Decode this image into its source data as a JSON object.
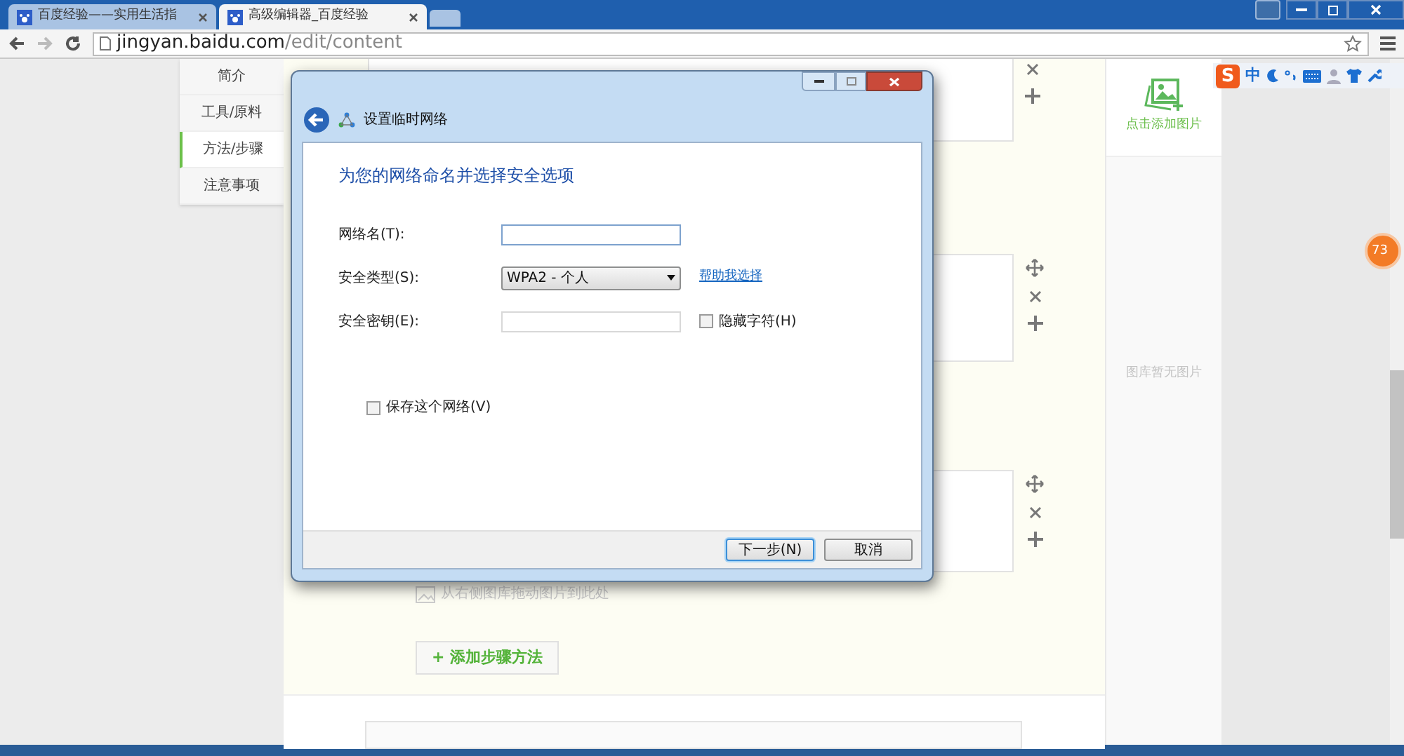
{
  "browser": {
    "tabs": [
      {
        "title": "百度经验——实用生活指",
        "selected": false
      },
      {
        "title": "高级编辑器_百度经验",
        "selected": true
      }
    ],
    "url_host": "jingyan.baidu.com",
    "url_path": "/edit/content"
  },
  "side_nav": [
    {
      "label": "简介",
      "selected": false
    },
    {
      "label": "工具/原料",
      "selected": false
    },
    {
      "label": "方法/步骤",
      "selected": true
    },
    {
      "label": "注意事项",
      "selected": false
    }
  ],
  "editor": {
    "drop_hint": "从右侧图库拖动图片到此处",
    "add_step_button": "+ 添加步骤方法"
  },
  "gallery": {
    "add_label": "点击添加图片",
    "empty_label": "图库暂无图片"
  },
  "ime": {
    "logo": "S",
    "mode": "中"
  },
  "badge": "73",
  "dialog": {
    "title": "设置临时网络",
    "heading": "为您的网络命名并选择安全选项",
    "fields": [
      {
        "kind": "input",
        "label": "网络名(T):"
      },
      {
        "kind": "select",
        "label": "安全类型(S):",
        "value": "WPA2 - 个人",
        "link": "帮助我选择"
      },
      {
        "kind": "input",
        "label": "安全密钥(E):",
        "checkbox": {
          "label": "隐藏字符(H)",
          "checked": false
        }
      }
    ],
    "save_checkbox": {
      "label": "保存这个网络(V)",
      "checked": false
    },
    "buttons": [
      {
        "label": "下一步(N)",
        "default": true
      },
      {
        "label": "取消",
        "default": false
      }
    ]
  }
}
